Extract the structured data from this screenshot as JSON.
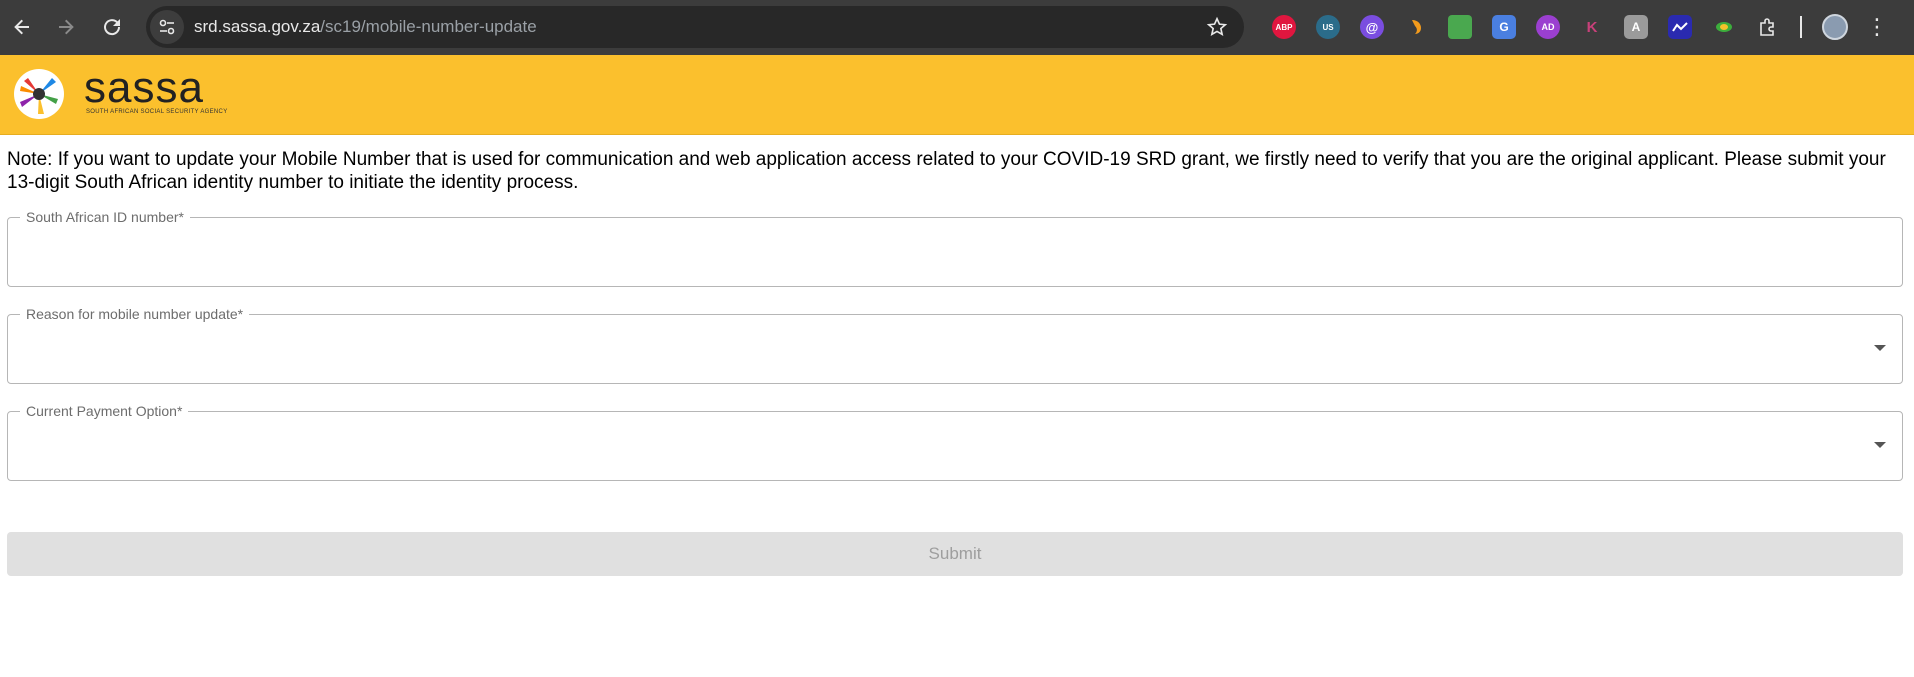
{
  "browser": {
    "url_domain": "srd.sassa.gov.za",
    "url_path": "/sc19/mobile-number-update",
    "extensions": [
      {
        "name": "adblock-plus-icon",
        "label": "ABP",
        "color": "#e0163f"
      },
      {
        "name": "vpn-us-icon",
        "label": "US",
        "color": "#2b6c8a"
      },
      {
        "name": "at-sign-icon",
        "label": "@",
        "color": "#7a4de0"
      },
      {
        "name": "shield-orange-icon",
        "label": "",
        "color": "#f39b1c"
      },
      {
        "name": "wallet-icon",
        "label": "",
        "color": "#4aa84f"
      },
      {
        "name": "translate-icon",
        "label": "G",
        "color": "#4a7fe0"
      },
      {
        "name": "ad-icon",
        "label": "AD",
        "color": "#9b3fd0"
      },
      {
        "name": "k-icon",
        "label": "K",
        "color": "#3c3c3c"
      },
      {
        "name": "font-icon",
        "label": "A",
        "color": "#9b9b9b"
      },
      {
        "name": "chart-icon",
        "label": "",
        "color": "#2a2ab0"
      },
      {
        "name": "rocket-icon",
        "label": "",
        "color": "#3cae3c"
      },
      {
        "name": "puzzle-icon",
        "label": "",
        "color": "#3c3c3c"
      }
    ]
  },
  "header": {
    "logo_text": "sassa",
    "logo_subtitle": "SOUTH AFRICAN SOCIAL SECURITY AGENCY",
    "brand_color": "#fbc02d"
  },
  "form": {
    "note": "Note: If you want to update your Mobile Number that is used for communication and web application access related to your COVID-19 SRD grant, we firstly need to verify that you are the original applicant. Please submit your 13-digit South African identity number to initiate the identity process.",
    "id_label": "South African ID number*",
    "id_value": "",
    "reason_label": "Reason for mobile number update*",
    "reason_value": "",
    "payment_label": "Current Payment Option*",
    "payment_value": "",
    "submit_label": "Submit"
  }
}
